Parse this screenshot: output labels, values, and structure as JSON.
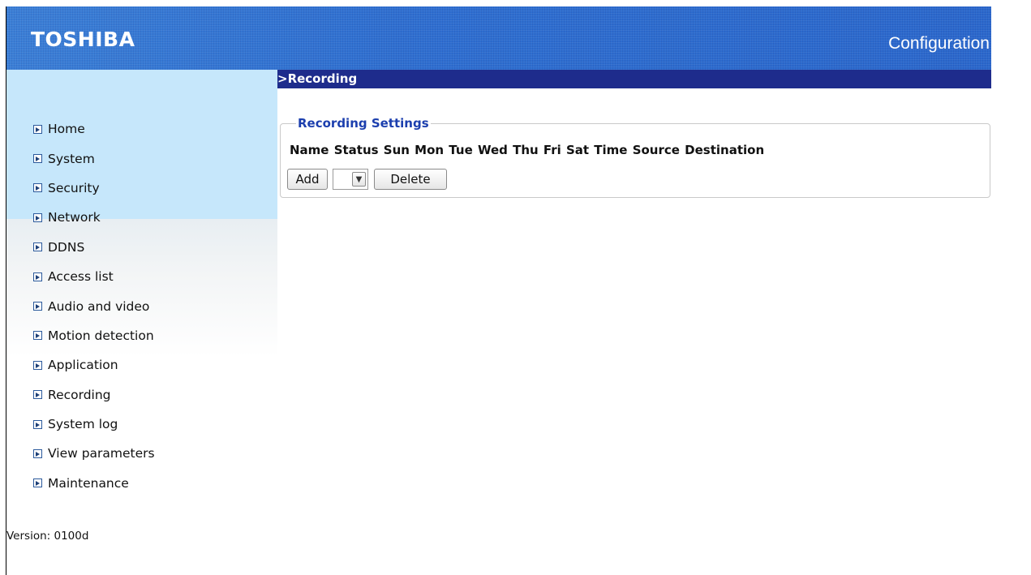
{
  "header": {
    "brand": "TOSHIBA",
    "title": "Configuration"
  },
  "section": {
    "breadcrumb": ">Recording"
  },
  "sidebar": {
    "items": [
      {
        "label": "Home"
      },
      {
        "label": "System"
      },
      {
        "label": "Security"
      },
      {
        "label": "Network"
      },
      {
        "label": "DDNS"
      },
      {
        "label": "Access list"
      },
      {
        "label": "Audio and video"
      },
      {
        "label": "Motion detection"
      },
      {
        "label": "Application"
      },
      {
        "label": "Recording"
      },
      {
        "label": "System log"
      },
      {
        "label": "View parameters"
      },
      {
        "label": "Maintenance"
      }
    ],
    "version": "Version: 0100d"
  },
  "recording_settings": {
    "legend": "Recording Settings",
    "columns": "Name Status Sun Mon Tue Wed Thu Fri Sat Time Source Destination",
    "add_label": "Add",
    "select_value": "",
    "delete_label": "Delete"
  }
}
